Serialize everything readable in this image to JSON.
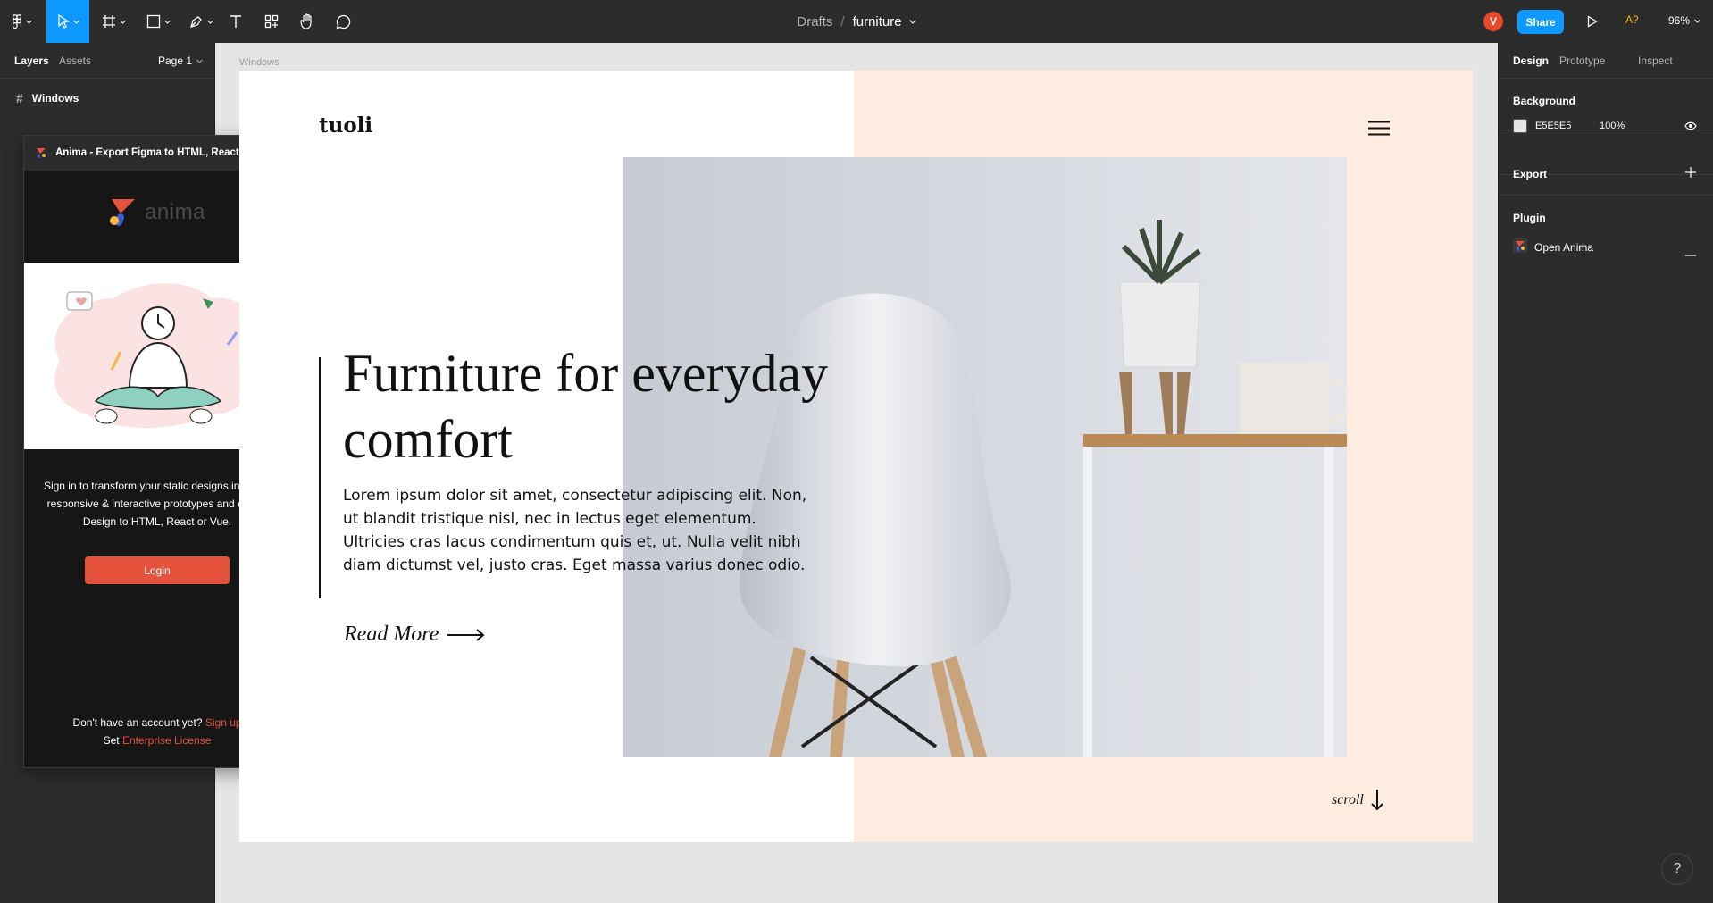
{
  "toolbar": {
    "breadcrumb_parent": "Drafts",
    "breadcrumb_sep": "/",
    "file_name": "furniture",
    "avatar_initial": "V",
    "share_label": "Share",
    "a11y_label": "A?",
    "zoom_level": "96%",
    "accent_color": "#0d99ff",
    "tools": [
      "main-menu-icon",
      "move-icon",
      "frame-icon",
      "shape-icon",
      "pen-icon",
      "text-icon",
      "components-icon",
      "hand-icon",
      "comment-icon"
    ]
  },
  "left_panel": {
    "tabs": [
      "Layers",
      "Assets"
    ],
    "page_selector": "Page 1",
    "layers": [
      {
        "name": "Windows",
        "icon": "frame-hash-icon"
      }
    ]
  },
  "plugin": {
    "title": "Anima - Export Figma to HTML, React & ...",
    "logo_text": "anima",
    "description": "Sign in to transform your static designs into fully responsive & interactive prototypes and export Design to HTML, React or Vue.",
    "login_label": "Login",
    "no_account_text": "Don't have an account yet?",
    "signup_label": "Sign up",
    "set_text": "Set",
    "enterprise_label": "Enterprise License",
    "accent_color": "#e6533c"
  },
  "canvas": {
    "frame_label": "Windows",
    "brand": "tuoli",
    "headline": "Furniture for everyday comfort",
    "body": "Lorem ipsum dolor sit amet, consectetur adipiscing elit. Non, ut blandit tristique nisl, nec in lectus eget elementum. Ultricies cras lacus condimentum quis et, ut. Nulla velit nibh diam dictumst vel, justo cras. Eget massa varius donec odio.",
    "read_more": "Read More",
    "scroll_label": "scroll",
    "peach_color": "#ffece0"
  },
  "right_panel": {
    "tabs": [
      "Design",
      "Prototype",
      "Inspect"
    ],
    "background_title": "Background",
    "background_hex": "E5E5E5",
    "background_opacity": "100%",
    "export_title": "Export",
    "plugin_title": "Plugin",
    "plugin_name": "Open Anima"
  },
  "help_label": "?"
}
